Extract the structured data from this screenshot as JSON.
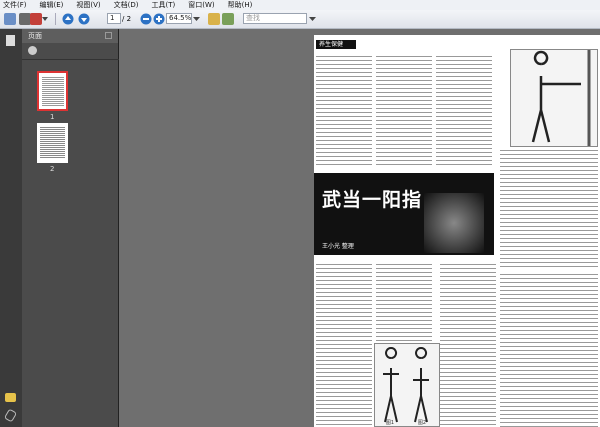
{
  "menu": {
    "items": [
      "文件(F)",
      "编辑(E)",
      "视图(V)",
      "文档(D)",
      "工具(T)",
      "窗口(W)",
      "帮助(H)"
    ]
  },
  "toolbar": {
    "page_current": "1",
    "page_total": "/ 2",
    "zoom": "64.5%",
    "search_placeholder": "查找"
  },
  "panel": {
    "title": "页面",
    "thumbnails": [
      {
        "label": "1"
      },
      {
        "label": "2"
      }
    ]
  },
  "document": {
    "header": "养生保健",
    "article_title": "武当一阳指",
    "author": "王小光 整理",
    "sections": [
      "二、双掌推阳",
      "三、双掌运阳",
      "一、通元一气",
      "四、推阳化"
    ],
    "figure_labels": [
      "图1",
      "图2",
      "图3"
    ]
  }
}
